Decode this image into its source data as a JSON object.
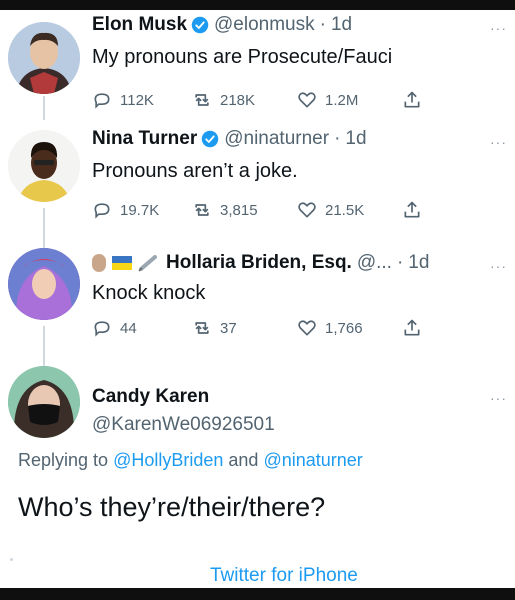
{
  "tweets": [
    {
      "name": "Elon Musk",
      "handle": "@elonmusk",
      "time": "1d",
      "text": "My pronouns are Prosecute/Fauci",
      "replies": "112K",
      "retweets": "218K",
      "likes": "1.2M",
      "verified": true
    },
    {
      "name": "Nina Turner",
      "handle": "@ninaturner",
      "time": "1d",
      "text": "Pronouns aren’t a joke.",
      "replies": "19.7K",
      "retweets": "3,815",
      "likes": "21.5K",
      "verified": true
    },
    {
      "name": "Hollaria Briden, Esq.",
      "handle": "@...",
      "time": "1d",
      "text": "Knock knock",
      "replies": "44",
      "retweets": "37",
      "likes": "1,766",
      "verified": false
    }
  ],
  "main": {
    "name": "Candy Karen",
    "handle": "@KarenWe06926501",
    "replying_prefix": "Replying to",
    "reply_to_1": "@HollyBriden",
    "reply_and": "and",
    "reply_to_2": "@ninaturner",
    "text": "Who’s they’re/their/there?",
    "source": "Twitter for iPhone"
  },
  "ui": {
    "more_glyph": "···",
    "separator": "·",
    "accent_color": "#1d9bf0",
    "icons": [
      "reply-icon",
      "retweet-icon",
      "like-icon",
      "share-icon",
      "verified-badge-icon"
    ]
  }
}
